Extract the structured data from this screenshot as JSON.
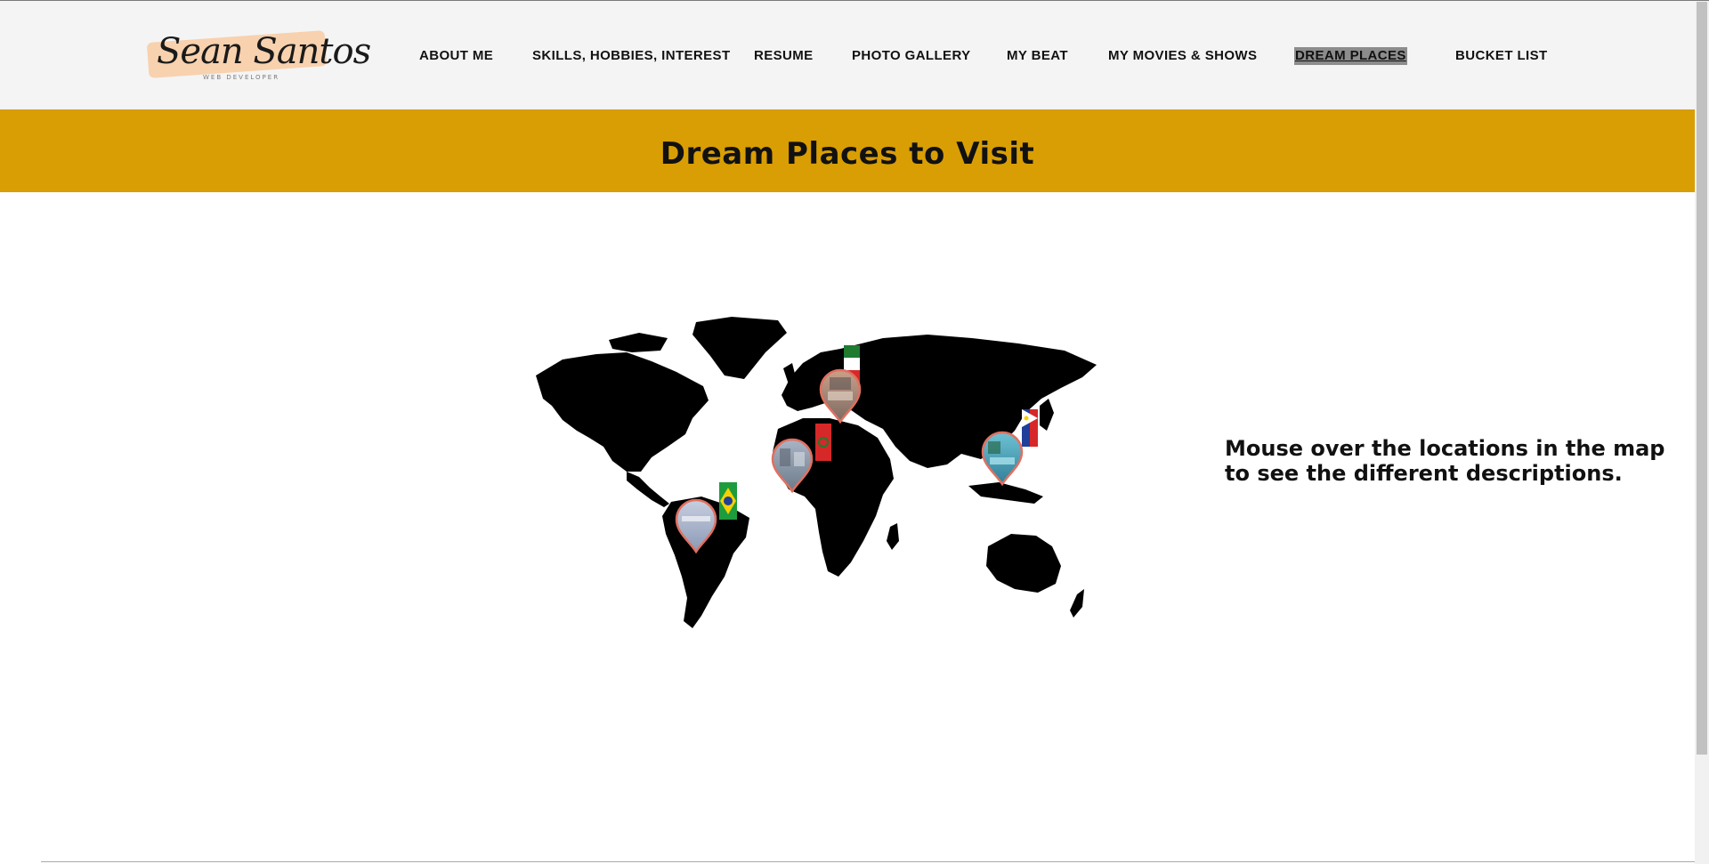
{
  "logo": {
    "name": "Sean Santos",
    "subtitle": "WEB DEVELOPER"
  },
  "nav": {
    "items": [
      "ABOUT ME",
      "SKILLS, HOBBIES, INTEREST",
      "RESUME",
      "PHOTO GALLERY",
      "MY BEAT",
      "MY MOVIES & SHOWS",
      "DREAM PLACES",
      "BUCKET LIST"
    ],
    "active_index": 6
  },
  "banner": {
    "title": "Dream Places to Visit",
    "color": "#d99e04"
  },
  "instructions": "Mouse over the locations in the map to see the different descriptions.",
  "map": {
    "markers": [
      {
        "name": "italy-marker",
        "flag": "italy-flag-icon"
      },
      {
        "name": "morocco-marker",
        "flag": "morocco-flag-icon"
      },
      {
        "name": "brazil-marker",
        "flag": "brazil-flag-icon"
      },
      {
        "name": "philippines-marker",
        "flag": "philippines-flag-icon"
      }
    ]
  }
}
